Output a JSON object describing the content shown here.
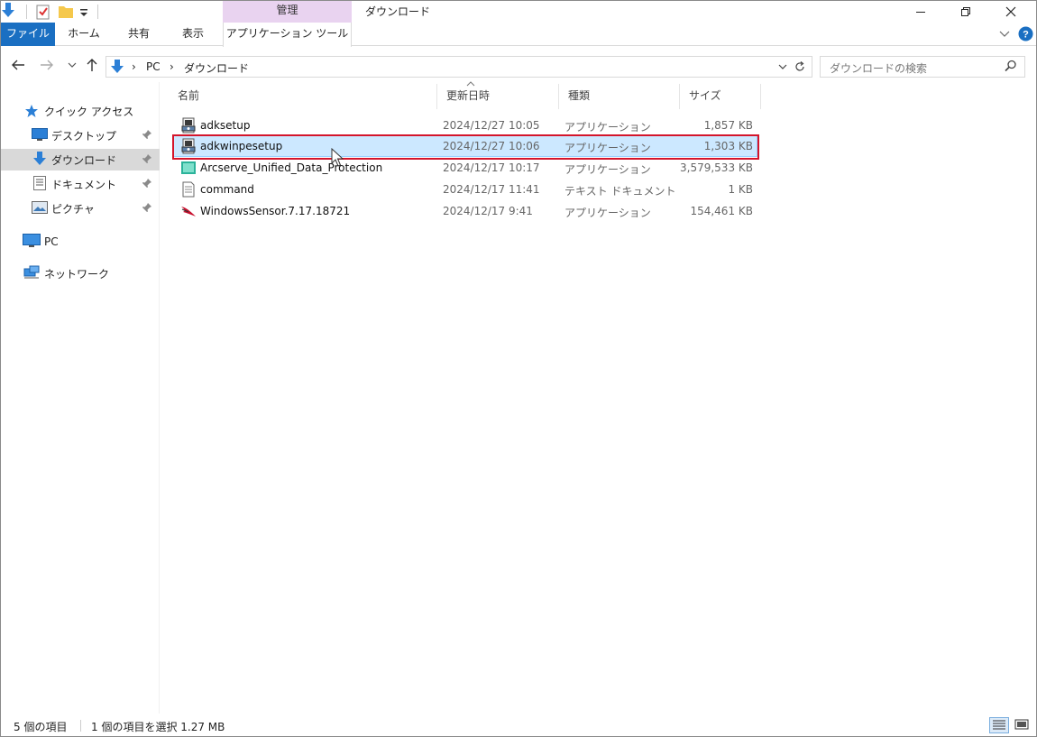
{
  "titlebar": {
    "context_label": "管理",
    "window_title": "ダウンロード"
  },
  "ribbon": {
    "tabs": [
      {
        "label": "ファイル"
      },
      {
        "label": "ホーム"
      },
      {
        "label": "共有"
      },
      {
        "label": "表示"
      },
      {
        "label": "アプリケーション ツール"
      }
    ]
  },
  "address": {
    "crumbs": [
      "PC",
      "ダウンロード"
    ],
    "search_placeholder": "ダウンロードの検索"
  },
  "nav": {
    "quick_access": "クイック アクセス",
    "items": [
      {
        "label": "デスクトップ",
        "icon": "desktop-icon"
      },
      {
        "label": "ダウンロード",
        "icon": "download-icon"
      },
      {
        "label": "ドキュメント",
        "icon": "document-icon"
      },
      {
        "label": "ピクチャ",
        "icon": "pictures-icon"
      }
    ],
    "pc": "PC",
    "network": "ネットワーク"
  },
  "columns": {
    "name": "名前",
    "date": "更新日時",
    "type": "種類",
    "size": "サイズ"
  },
  "files": [
    {
      "name": "adksetup",
      "date": "2024/12/27 10:05",
      "type": "アプリケーション",
      "size": "1,857 KB",
      "icon": "installer-icon"
    },
    {
      "name": "adkwinpesetup",
      "date": "2024/12/27 10:06",
      "type": "アプリケーション",
      "size": "1,303 KB",
      "icon": "installer-icon"
    },
    {
      "name": "Arcserve_Unified_Data_Protection",
      "date": "2024/12/17 10:17",
      "type": "アプリケーション",
      "size": "3,579,533 KB",
      "icon": "arcserve-icon"
    },
    {
      "name": "command",
      "date": "2024/12/17 11:41",
      "type": "テキスト ドキュメント",
      "size": "1 KB",
      "icon": "text-file-icon"
    },
    {
      "name": "WindowsSensor.7.17.18721",
      "date": "2024/12/17 9:41",
      "type": "アプリケーション",
      "size": "154,461 KB",
      "icon": "falcon-icon"
    }
  ],
  "status": {
    "count": "5 個の項目",
    "selection": "1 個の項目を選択  1.27 MB"
  },
  "colors": {
    "file_tab": "#1a6fc2",
    "context_tab": "#e9d3f0",
    "selection": "#cce8ff",
    "highlight": "#d4152b"
  }
}
